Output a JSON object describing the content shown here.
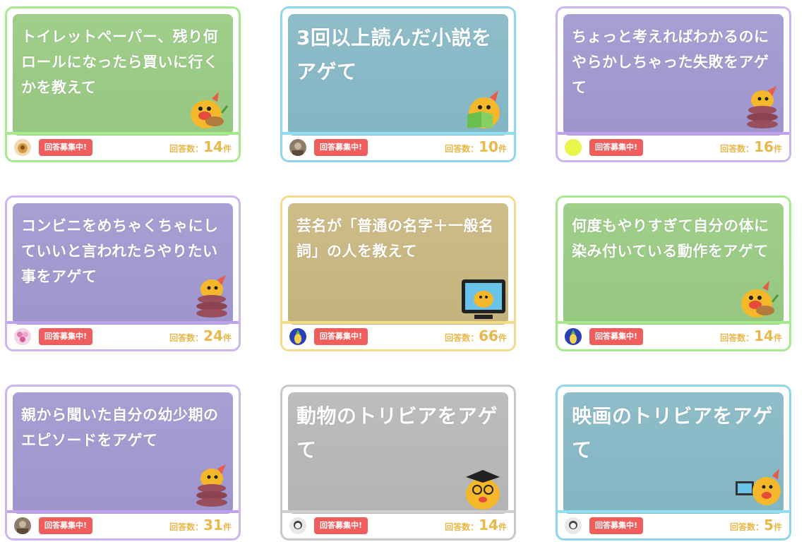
{
  "cards": [
    {
      "title": "トイレットペーパー、残り何ロールになったら買いに行くかを教えて",
      "badge": "回答募集中!",
      "count_label": "回答数：",
      "count": "14",
      "unit": "件",
      "mascot": "mascot-eating-icon",
      "avatar": "food-avatar",
      "theme": "green"
    },
    {
      "title": "3回以上読んだ小説をアゲて",
      "badge": "回答募集中!",
      "count_label": "回答数：",
      "count": "10",
      "unit": "件",
      "mascot": "mascot-reading-icon",
      "avatar": "photo-avatar",
      "theme": "blue"
    },
    {
      "title": "ちょっと考えればわかるのにやらかしちゃった失敗をアゲて",
      "badge": "回答募集中!",
      "count_label": "回答数：",
      "count": "16",
      "unit": "件",
      "mascot": "mascot-tied-icon",
      "avatar": "yellow-avatar",
      "theme": "purple"
    },
    {
      "title": "コンビニをめちゃくちゃにしていいと言われたらやりたい事をアゲて",
      "badge": "回答募集中!",
      "count_label": "回答数：",
      "count": "24",
      "unit": "件",
      "mascot": "mascot-tied-icon",
      "avatar": "flower-avatar",
      "theme": "purple"
    },
    {
      "title": "芸名が「普通の名字＋一般名詞」の人を教えて",
      "badge": "回答募集中!",
      "count_label": "回答数：",
      "count": "66",
      "unit": "件",
      "mascot": "mascot-tv-icon",
      "avatar": "pineapple-avatar",
      "theme": "gold"
    },
    {
      "title": "何度もやりすぎて自分の体に染み付いている動作をアゲて",
      "badge": "回答募集中!",
      "count_label": "回答数：",
      "count": "14",
      "unit": "件",
      "mascot": "mascot-eating-icon",
      "avatar": "pineapple-avatar",
      "theme": "green"
    },
    {
      "title": "親から聞いた自分の幼少期のエピソードをアゲて",
      "badge": "回答募集中!",
      "count_label": "回答数：",
      "count": "31",
      "unit": "件",
      "mascot": "mascot-tied-icon",
      "avatar": "photo-avatar",
      "theme": "purple"
    },
    {
      "title": "動物のトリビアをアゲて",
      "badge": "回答募集中!",
      "count_label": "回答数：",
      "count": "14",
      "unit": "件",
      "mascot": "mascot-graduate-icon",
      "avatar": "face-avatar",
      "theme": "gray"
    },
    {
      "title": "映画のトリビアをアゲて",
      "badge": "回答募集中!",
      "count_label": "回答数：",
      "count": "5",
      "unit": "件",
      "mascot": "mascot-computer-icon",
      "avatar": "face-avatar",
      "theme": "blue"
    }
  ],
  "colors": {
    "badge": "#ef5e5c",
    "count": "#e8b84a",
    "mascot": "#f5b82a"
  }
}
